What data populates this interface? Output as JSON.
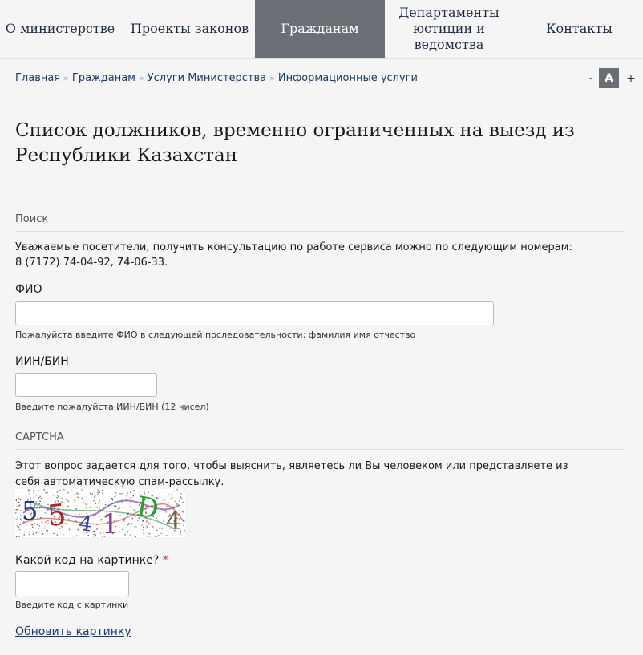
{
  "nav": {
    "items": [
      {
        "label": "О министерстве"
      },
      {
        "label": "Проекты законов"
      },
      {
        "label": "Гражданам"
      },
      {
        "label": "Департаменты юстиции и ведомства"
      },
      {
        "label": "Контакты"
      }
    ]
  },
  "breadcrumb": {
    "items": [
      "Главная",
      "Гражданам",
      "Услуги Министерства",
      "Информационные услуги"
    ],
    "separator": "»"
  },
  "font_controls": {
    "decrease": "-",
    "current": "A",
    "increase": "+"
  },
  "page": {
    "title": "Список должников, временно ограниченных на выезд из Республики Казахстан"
  },
  "search": {
    "section_label": "Поиск",
    "info_line1": "Уважаемые посетители, получить консультацию по работе сервиса можно по следующим номерам:",
    "info_line2": "8 (7172) 74-04-92, 74-06-33.",
    "fio": {
      "label": "ФИО",
      "value": "",
      "hint": "Пожалуйста введите ФИО в следующей последовательности: фамилия имя отчество"
    },
    "iin": {
      "label": "ИИН/БИН",
      "value": "",
      "hint": "Введите пожалуйста ИИН/БИН (12 чисел)"
    }
  },
  "captcha": {
    "section_label": "CAPTCHA",
    "description": "Этот вопрос задается для того, чтобы выяснить, являетесь ли Вы человеком или представляете из себя автоматическую спам-рассылку.",
    "image_text": "5541D4",
    "code_label": "Какой код на картинке?",
    "required_mark": "*",
    "code_value": "",
    "code_hint": "Введите код с картинки",
    "refresh_link": "Обновить картинку"
  },
  "colors": {
    "active_nav": "#6a6e75",
    "link": "#1f3a66",
    "required": "#c0392b"
  }
}
